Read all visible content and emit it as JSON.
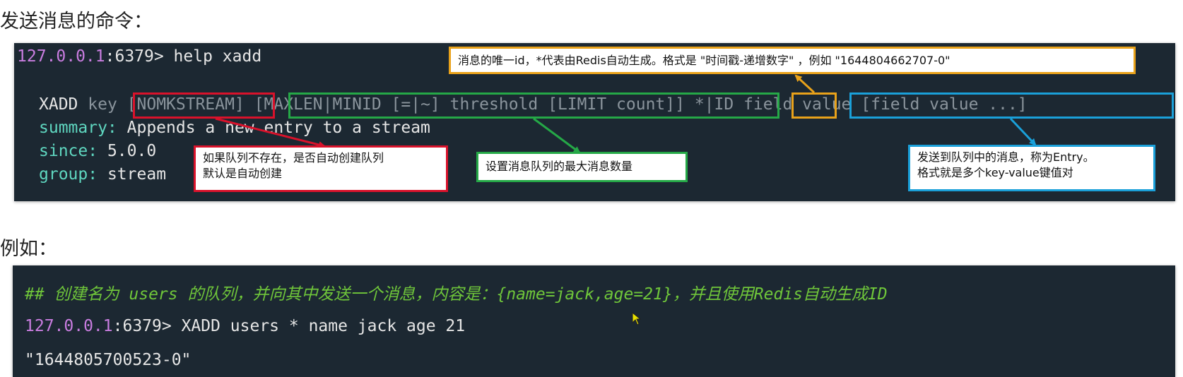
{
  "heading_send": "发送消息的命令：",
  "heading_example": "例如：",
  "terminal1": {
    "prompt_ip": "127.0.0.1",
    "prompt_rest": ":6379> help xadd",
    "syntax": {
      "cmd": "XADD",
      "key": "key",
      "nomkstream": "[NOMKSTREAM]",
      "maxlen": "[MAXLEN|MINID [=|~] threshold [LIMIT count]]",
      "id": "*|ID",
      "fields": "field value [field value ...]"
    },
    "summary_label": "summary:",
    "summary_value": "Appends a new entry to a stream",
    "since_label": "since:",
    "since_value": "5.0.0",
    "group_label": "group:",
    "group_value": "stream"
  },
  "callouts": {
    "id_note": "消息的唯一id，*代表由Redis自动生成。格式是 \"时间戳-递增数字\" ，例如 \"1644804662707-0\"",
    "nomkstream_note": "如果队列不存在，是否自动创建队列\n默认是自动创建",
    "maxlen_note": "设置消息队列的最大消息数量",
    "fields_note": "发送到队列中的消息，称为Entry。\n格式就是多个key-value键值对"
  },
  "terminal2": {
    "comment": "## 创建名为 users 的队列，并向其中发送一个消息，内容是：{name=jack,age=21}，并且使用Redis自动生成ID",
    "prompt_ip": "127.0.0.1",
    "prompt_rest": ":6379> XADD users * name jack age 21",
    "output": "\"1644805700523-0\""
  },
  "colors": {
    "red": "#d9122b",
    "green": "#25a847",
    "yellow": "#e9a21a",
    "blue": "#1aa0d9",
    "terminal_bg": "#1c2832"
  }
}
